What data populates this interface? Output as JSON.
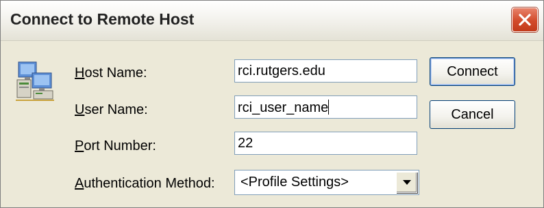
{
  "window": {
    "title": "Connect to Remote Host",
    "close_icon": "close-icon"
  },
  "form": {
    "app_icon": "network-computers-icon",
    "host": {
      "label_key": "H",
      "label_rest": "ost Name:",
      "value": "rci.rutgers.edu"
    },
    "user": {
      "label_key": "U",
      "label_rest": "ser Name:",
      "value": "rci_user_name"
    },
    "port": {
      "label_key": "P",
      "label_rest": "ort Number:",
      "value": "22"
    },
    "auth": {
      "label_key": "A",
      "label_rest": "uthentication Method:",
      "value": "<Profile Settings>",
      "arrow_icon": "dropdown-arrow-icon"
    }
  },
  "buttons": {
    "connect": "Connect",
    "cancel": "Cancel"
  },
  "colors": {
    "dialog_background": "#ece9d8",
    "field_border": "#7f9db9",
    "close_button": "#d24a2a",
    "default_button_border": "#003c74"
  }
}
